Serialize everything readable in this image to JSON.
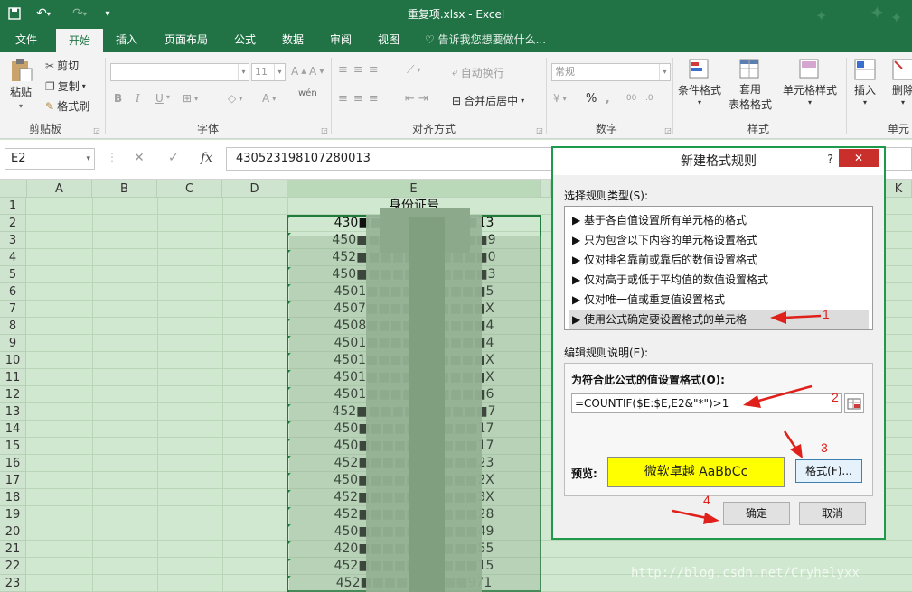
{
  "window": {
    "title": "重复项.xlsx - Excel"
  },
  "tabs": [
    "文件",
    "开始",
    "插入",
    "页面布局",
    "公式",
    "数据",
    "审阅",
    "视图"
  ],
  "tellme": "告诉我您想要做什么...",
  "ribbon": {
    "clipboard": {
      "paste": "粘贴",
      "cut": "剪切",
      "copy": "复制",
      "format_painter": "格式刷",
      "label": "剪贴板"
    },
    "font": {
      "font_size": "11",
      "label": "字体",
      "bold": "B",
      "italic": "I",
      "underline": "U",
      "font_color": "A",
      "phonetic": "wén"
    },
    "alignment": {
      "wrap": "自动换行",
      "merge": "合并后居中",
      "label": "对齐方式"
    },
    "number": {
      "format": "常规",
      "percent": "%",
      "comma": ",",
      "label": "数字"
    },
    "styles": {
      "conditional": "条件格式",
      "table_line1": "套用",
      "table_line2": "表格格式",
      "cell_styles": "单元格样式",
      "label": "样式"
    },
    "cells": {
      "insert": "插入",
      "delete": "删除",
      "label": "单元"
    }
  },
  "formula_bar": {
    "name_box": "E2",
    "fx": "fx",
    "value": "430523198107280013"
  },
  "columns": [
    "A",
    "B",
    "C",
    "D",
    "E",
    "K"
  ],
  "rows": [
    "1",
    "2",
    "3",
    "4",
    "5",
    "6",
    "7",
    "8",
    "9",
    "10",
    "11",
    "12",
    "13",
    "14",
    "15",
    "16",
    "17",
    "18",
    "19",
    "20",
    "21",
    "22",
    "23"
  ],
  "cells": {
    "header": "身份证号",
    "col_e": [
      "430■■■■■■■■■■13",
      "450■■■■■■■■■■■9",
      "452■■■■■■■■■■■0",
      "450■■■■■■■■■■■3",
      "4501■■■■■■■■■■5",
      "4507■■■■■■■■■■X",
      "4508■■■■■■■■■■4",
      "4501■■■■■■■■■■4",
      "4501■■■■■■■■■■X",
      "4501■■■■■■■■■■X",
      "4501■■■■■■■■■■6",
      "452■■■■■■■■■■■7",
      "450■■■■■■■■■■17",
      "450■■■■■■■■■■17",
      "452■■■■■■■■■■23",
      "450■■■■■■■■■■2X",
      "452■■■■■■■■■■3X",
      "452■■■■■■■■■■28",
      "450■■■■■■■■■■49",
      "420■■■■■■■■■■55",
      "452■■■■■■■■■■15",
      "452■■■■■■■■■971"
    ]
  },
  "dialog": {
    "title": "新建格式规则",
    "help": "?",
    "close": "✕",
    "select_label": "选择规则类型(S):",
    "rules": [
      "基于各自值设置所有单元格的格式",
      "只为包含以下内容的单元格设置格式",
      "仅对排名靠前或靠后的数值设置格式",
      "仅对高于或低于平均值的数值设置格式",
      "仅对唯一值或重复值设置格式",
      "使用公式确定要设置格式的单元格"
    ],
    "edit_label": "编辑规则说明(E):",
    "formula_label": "为符合此公式的值设置格式(O):",
    "formula": "=COUNTIF($E:$E,E2&\"*\")>1",
    "preview_label": "预览:",
    "preview_text": "微软卓越  AaBbCc",
    "format_button": "格式(F)...",
    "ok_button": "确定",
    "cancel_button": "取消"
  },
  "annotations": [
    "1",
    "2",
    "3",
    "4"
  ],
  "watermark": "http://blog.csdn.net/Cryhelyxx",
  "colors": {
    "excel_green": "#217346",
    "selection": "#1f9a4c",
    "preview_fill": "#ffff00",
    "annotation_red": "#e0201a"
  }
}
